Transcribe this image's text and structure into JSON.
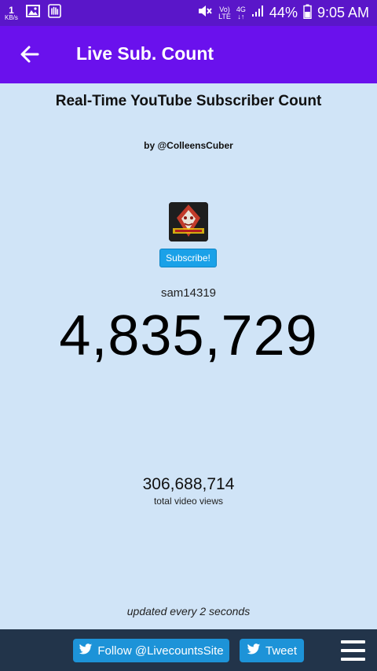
{
  "status_bar": {
    "speed_value": "1",
    "speed_unit": "KB/s",
    "network_top": "Vo)",
    "network_bottom": "LTE",
    "net_gen_top": "4G",
    "net_gen_bottom": "↓↑",
    "battery": "44%",
    "time": "9:05 AM",
    "icons": [
      "image-icon",
      "hand-icon",
      "mute-icon",
      "signal-icon",
      "battery-icon"
    ]
  },
  "app_bar": {
    "title": "Live Sub. Count",
    "back_icon": "arrow-left-icon"
  },
  "page": {
    "heading": "Real-Time YouTube Subscriber Count",
    "byline": "by @ColleensCuber"
  },
  "channel": {
    "subscribe_label": "Subscribe!",
    "name": "sam14319",
    "subscriber_count": "4,835,729",
    "total_views": "306,688,714",
    "views_label": "total video views"
  },
  "update_note": "updated every 2 seconds",
  "footer": {
    "follow_label": "Follow @LivecountsSite",
    "tweet_label": "Tweet",
    "menu_icon": "hamburger-menu-icon"
  },
  "colors": {
    "status_bar": "#5a16c9",
    "app_bar": "#6a11ed",
    "background": "#d0e4f7",
    "subscribe_button": "#1aa1e8",
    "footer": "#22344a",
    "twitter_button": "#1d93d8"
  }
}
